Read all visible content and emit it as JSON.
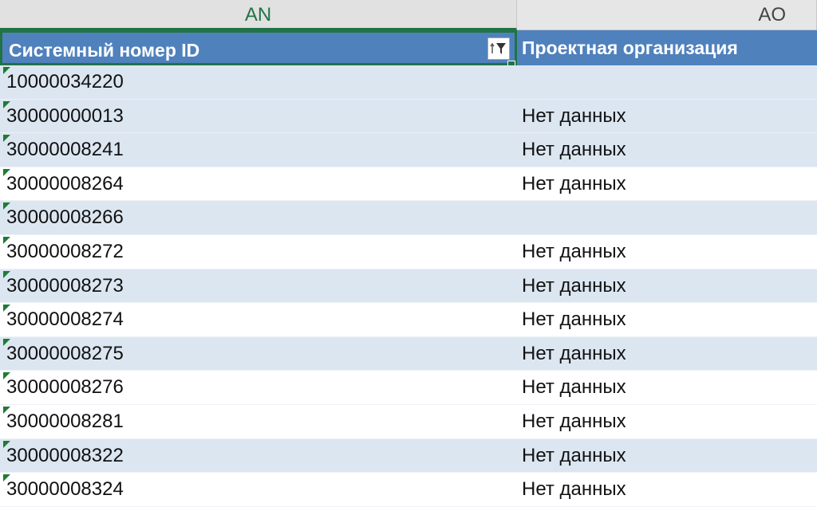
{
  "columns": [
    {
      "letter": "AN",
      "selected": true
    },
    {
      "letter": "AO",
      "selected": false
    }
  ],
  "header": {
    "an_label": "Системный номер ID",
    "ao_label": "Проектная организация",
    "fill_color": "#4f81bd",
    "filter_icon": "filter-sort-icon"
  },
  "rows": [
    {
      "id": "10000034220",
      "org": ""
    },
    {
      "id": "30000000013",
      "org": "Нет данных"
    },
    {
      "id": "30000008241",
      "org": "Нет данных"
    },
    {
      "id": "30000008264",
      "org": "Нет данных"
    },
    {
      "id": "30000008266",
      "org": ""
    },
    {
      "id": "30000008272",
      "org": "Нет данных"
    },
    {
      "id": "30000008273",
      "org": "Нет данных"
    },
    {
      "id": "30000008274",
      "org": "Нет данных"
    },
    {
      "id": "30000008275",
      "org": "Нет данных"
    },
    {
      "id": "30000008276",
      "org": "Нет данных"
    },
    {
      "id": "30000008281",
      "org": "Нет данных"
    },
    {
      "id": "30000008322",
      "org": "Нет данных"
    },
    {
      "id": "30000008324",
      "org": "Нет данных"
    }
  ],
  "colors": {
    "band_row": "#dce6f1",
    "selection": "#217346",
    "error_marker": "#1e7b34"
  }
}
